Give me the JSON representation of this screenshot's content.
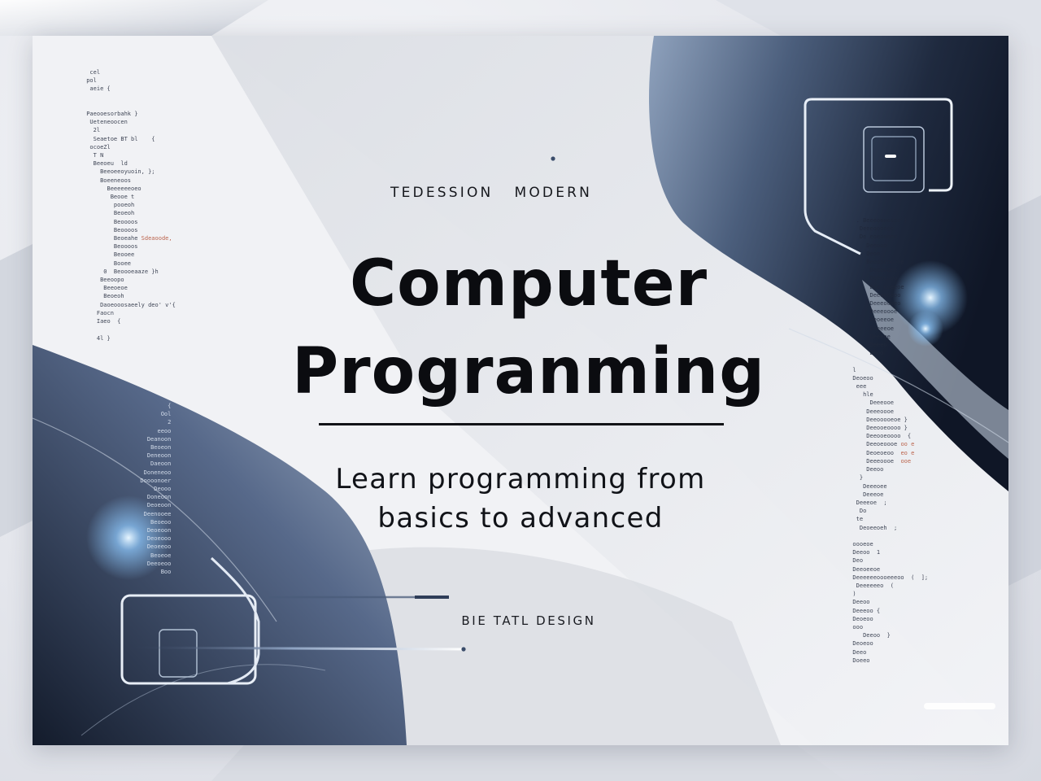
{
  "page": {
    "background": "#e4e6ec",
    "card_background": "#eceef2",
    "accent_dark": "#1c2638",
    "accent_steel": "#6f86a6",
    "glow": "#bfe2ff"
  },
  "poster": {
    "eyebrow_left": "TEDESSION",
    "eyebrow_right": "MODERN",
    "title_line1": "Computer",
    "title_line2": "Progranming",
    "subtitle_line1": "Learn programming from",
    "subtitle_line2": "basics to advanced",
    "footer_tag": "BIE TATL DESIGN"
  },
  "decor": {
    "top_right_icon": "code-window-icon",
    "bottom_left_icon": "code-window-icon",
    "code_text_left": "code-snippet-decoration",
    "code_text_right": "code-snippet-decoration"
  }
}
